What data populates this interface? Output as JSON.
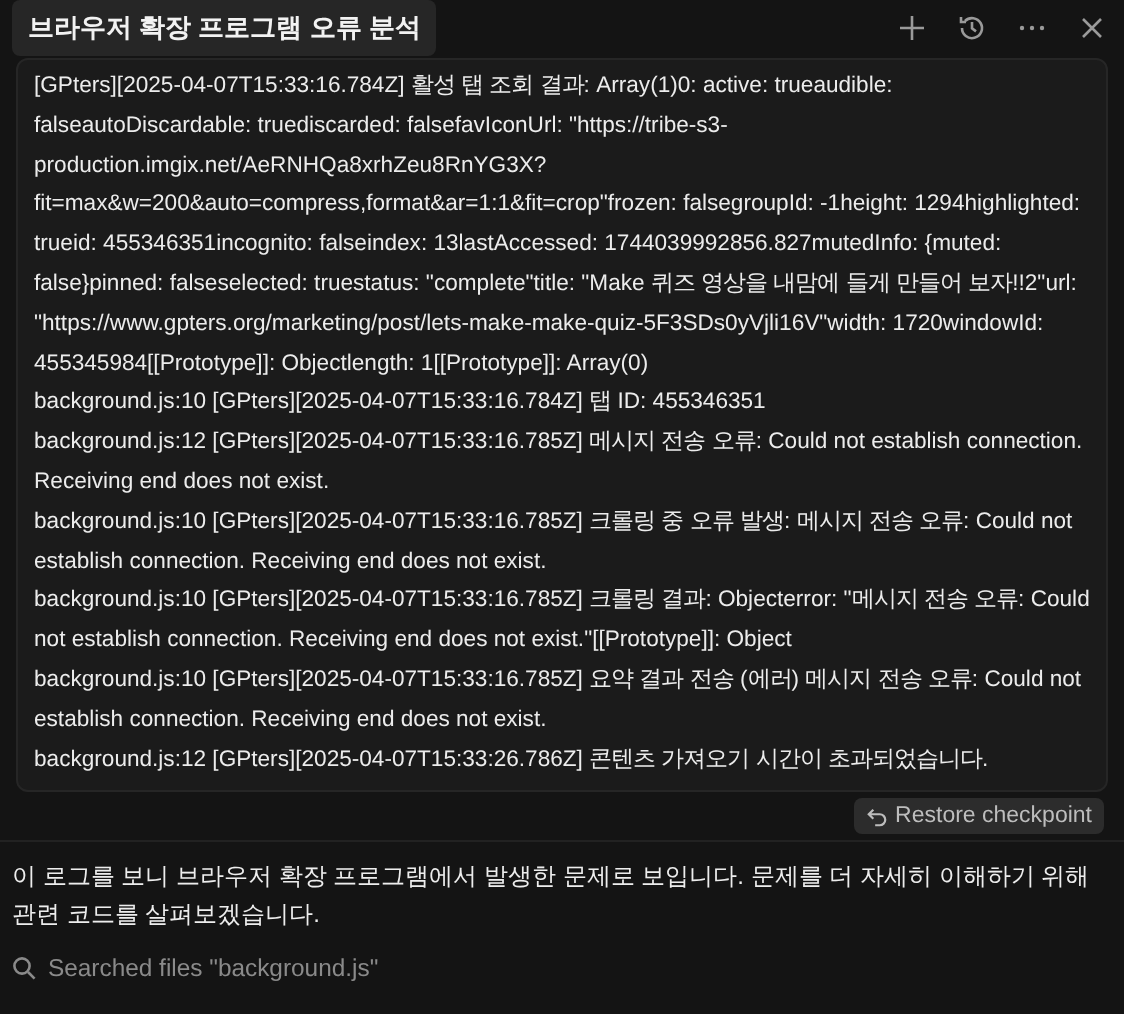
{
  "tab": {
    "title": "브라우저 확장 프로그램 오류 분석"
  },
  "log": [
    "[GPters][2025-04-07T15:33:16.784Z] 활성 탭 조회 결과: Array(1)0: active: trueaudible: falseautoDiscardable: truediscarded: falsefavIconUrl: \"https://tribe-s3-production.imgix.net/AeRNHQa8xrhZeu8RnYG3X?fit=max&w=200&auto=compress,format&ar=1:1&fit=crop\"frozen: falsegroupId: -1height: 1294highlighted: trueid: 455346351incognito: falseindex: 13lastAccessed: 1744039992856.827mutedInfo: {muted: false}pinned: falseselected: truestatus: \"complete\"title: \"Make 퀴즈 영상을 내맘에 들게 만들어 보자!!2\"url: \"https://www.gpters.org/marketing/post/lets-make-make-quiz-5F3SDs0yVjli16V\"width: 1720windowId: 455345984[[Prototype]]: Objectlength: 1[[Prototype]]: Array(0)",
    "background.js:10 [GPters][2025-04-07T15:33:16.784Z] 탭 ID: 455346351",
    "background.js:12 [GPters][2025-04-07T15:33:16.785Z] 메시지 전송 오류: Could not establish connection. Receiving end does not exist.",
    "background.js:10 [GPters][2025-04-07T15:33:16.785Z] 크롤링 중 오류 발생: 메시지 전송 오류: Could not establish connection. Receiving end does not exist.",
    "background.js:10 [GPters][2025-04-07T15:33:16.785Z] 크롤링 결과: Objecterror: \"메시지 전송 오류: Could not establish connection. Receiving end does not exist.\"[[Prototype]]: Object",
    "background.js:10 [GPters][2025-04-07T15:33:16.785Z] 요약 결과 전송 (에러) 메시지 전송 오류: Could not establish connection. Receiving end does not exist.",
    "background.js:12 [GPters][2025-04-07T15:33:26.786Z] 콘텐츠 가져오기 시간이 초과되었습니다."
  ],
  "restore_button": "Restore checkpoint",
  "reply": "이 로그를 보니 브라우저 확장 프로그램에서 발생한 문제로 보입니다. 문제를 더 자세히 이해하기 위해 관련 코드를 살펴보겠습니다.",
  "search_step": "Searched files \"background.js\""
}
